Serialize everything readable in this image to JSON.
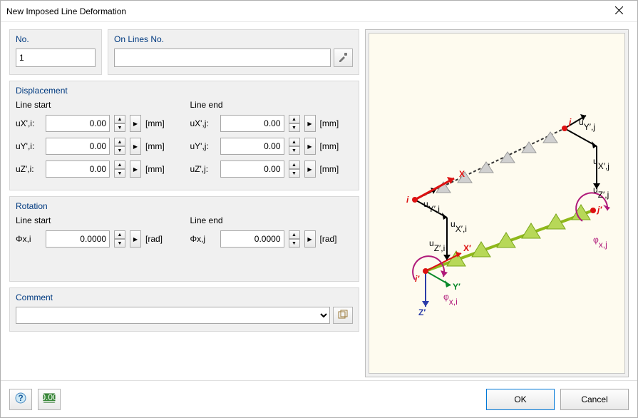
{
  "title": "New Imposed Line Deformation",
  "groups": {
    "no_label": "No.",
    "on_lines_label": "On Lines No.",
    "displacement_label": "Displacement",
    "rotation_label": "Rotation",
    "comment_label": "Comment"
  },
  "no_value": "1",
  "on_lines_value": "",
  "displacement": {
    "line_start_label": "Line start",
    "line_end_label": "Line end",
    "start": {
      "ux_label": "uX',i:",
      "ux_value": "0.00",
      "ux_unit": "[mm]",
      "uy_label": "uY',i:",
      "uy_value": "0.00",
      "uy_unit": "[mm]",
      "uz_label": "uZ',i:",
      "uz_value": "0.00",
      "uz_unit": "[mm]"
    },
    "end": {
      "ux_label": "uX',j:",
      "ux_value": "0.00",
      "ux_unit": "[mm]",
      "uy_label": "uY',j:",
      "uy_value": "0.00",
      "uy_unit": "[mm]",
      "uz_label": "uZ',j:",
      "uz_value": "0.00",
      "uz_unit": "[mm]"
    }
  },
  "rotation": {
    "line_start_label": "Line start",
    "line_end_label": "Line end",
    "start": {
      "phi_label": "Φx,i",
      "phi_value": "0.0000",
      "phi_unit": "[rad]"
    },
    "end": {
      "phi_label": "Φx,j",
      "phi_value": "0.0000",
      "phi_unit": "[rad]"
    }
  },
  "comment_value": "",
  "footer": {
    "ok": "OK",
    "cancel": "Cancel"
  }
}
